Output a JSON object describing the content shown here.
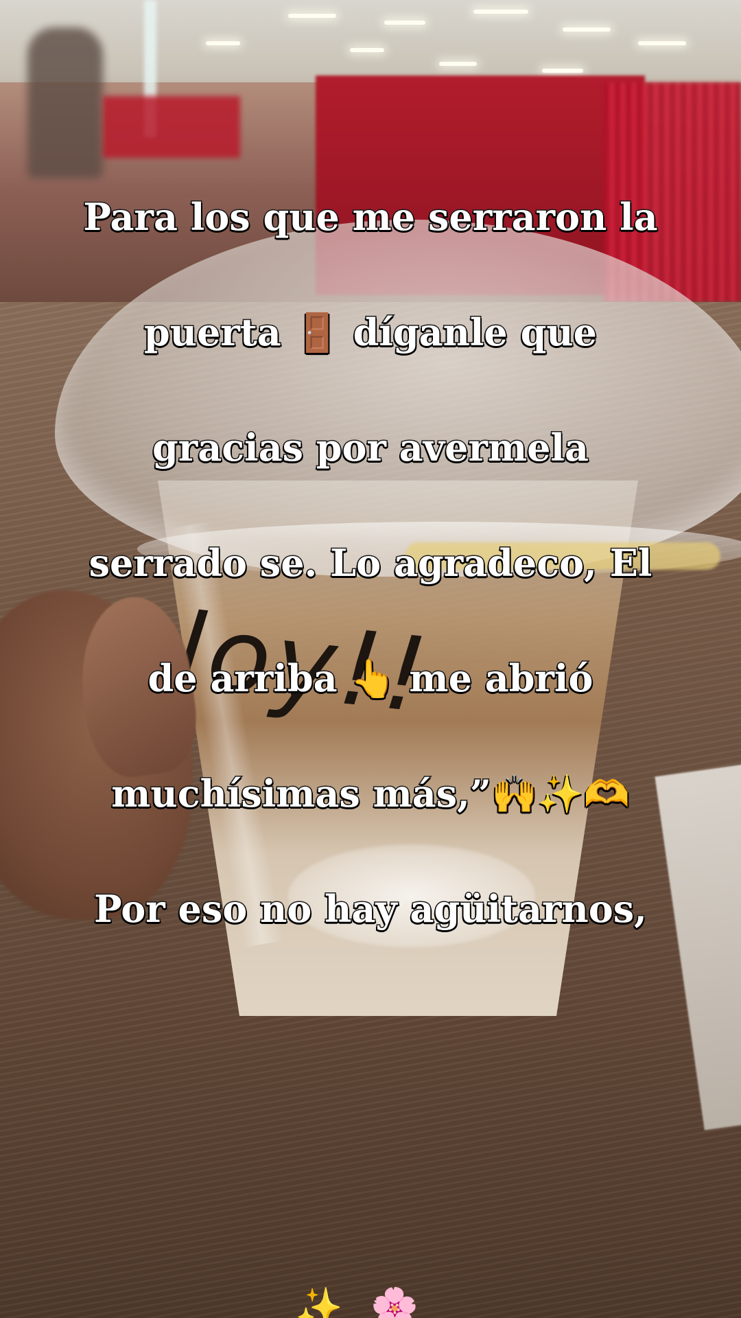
{
  "caption": {
    "lines": [
      "Para los que me serraron la",
      "puerta 🚪 díganle que",
      "gracias por avermela",
      "serrado se. Lo agradeco, El",
      "de arriba 👆 me abrió",
      "muchísimas más,”🙌✨🫶",
      "Por eso no hay agüitarnos,"
    ]
  },
  "cup": {
    "handwriting": "loy!!"
  },
  "bottom_emojis": "✨🌸"
}
